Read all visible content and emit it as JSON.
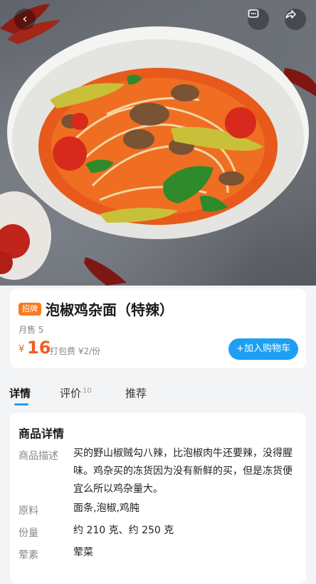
{
  "header": {
    "back_icon": "chevron-left-icon",
    "chat_icon": "chat-bubble-icon",
    "share_icon": "share-icon"
  },
  "product": {
    "badge": "招牌",
    "name": "泡椒鸡杂面（特辣）",
    "monthly_sales": "月售 5",
    "price_symbol": "¥",
    "price": "16",
    "packaging_fee": "打包费 ¥2/份",
    "add_to_cart": "+加入购物车"
  },
  "tabs": [
    {
      "label": "详情",
      "active": true
    },
    {
      "label": "评价",
      "count": "10"
    },
    {
      "label": "推荐"
    }
  ],
  "details": {
    "title": "商品详情",
    "rows": [
      {
        "label": "商品描述",
        "value": "买的野山椒贼勾八辣，比泡椒肉牛还要辣，没得腥味。鸡杂买的冻货因为没有新鲜的买，但是冻货便宜么所以鸡杂量大。"
      },
      {
        "label": "原料",
        "value": "面条,泡椒,鸡肫"
      },
      {
        "label": "份量",
        "value": "约 210 克、约 250 克"
      },
      {
        "label": "荤素",
        "value": "荤菜"
      }
    ]
  },
  "colors": {
    "accent_blue": "#1d9ff3",
    "price_orange": "#f25d21",
    "badge_orange": "#f77a1e"
  }
}
